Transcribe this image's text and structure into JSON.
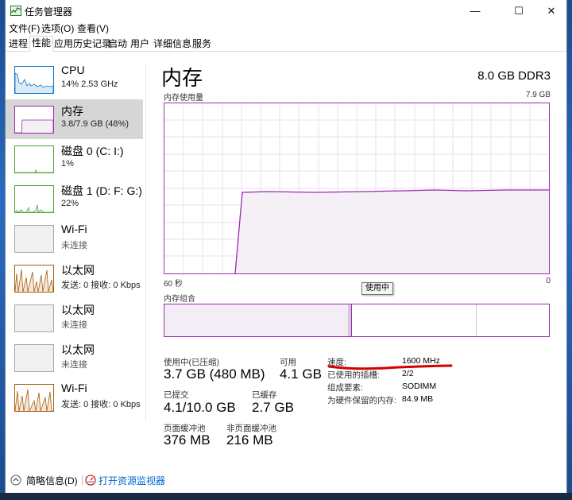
{
  "window": {
    "title": "任务管理器",
    "controls": {
      "minimize": "—",
      "maximize": "☐",
      "close": "✕"
    }
  },
  "menu": [
    "文件(F)",
    "选项(O)",
    "查看(V)"
  ],
  "tabs": [
    "进程",
    "性能",
    "应用历史记录",
    "启动",
    "用户",
    "详细信息",
    "服务"
  ],
  "active_tab": "性能",
  "sidebar": {
    "items": [
      {
        "name": "CPU",
        "sub": "14% 2.53 GHz",
        "selected": false,
        "color": "#1174c8"
      },
      {
        "name": "内存",
        "sub": "3.8/7.9 GB (48%)",
        "selected": true,
        "color": "#9b2cad"
      },
      {
        "name": "磁盘 0 (C: I:)",
        "sub": "1%",
        "selected": false,
        "color": "#4ea72e"
      },
      {
        "name": "磁盘 1 (D: F: G:)",
        "sub": "22%",
        "selected": false,
        "color": "#4ea72e"
      },
      {
        "name": "Wi-Fi",
        "sub": "未连接",
        "selected": false,
        "color": "#a7a7a7"
      },
      {
        "name": "以太网",
        "sub": "发送: 0 接收: 0 Kbps",
        "selected": false,
        "color": "#a75d12"
      },
      {
        "name": "以太网",
        "sub": "未连接",
        "selected": false,
        "color": "#a7a7a7"
      },
      {
        "name": "以太网",
        "sub": "未连接",
        "selected": false,
        "color": "#a7a7a7"
      },
      {
        "name": "Wi-Fi",
        "sub": "发送: 0 接收: 0 Kbps",
        "selected": false,
        "color": "#a75d12"
      }
    ]
  },
  "memory": {
    "title": "内存",
    "spec": "8.0 GB DDR3",
    "usage_label": "内存使用量",
    "max_label": "7.9 GB",
    "axis_left": "60 秒",
    "axis_right": "0",
    "tooltip": "使用中",
    "composition_label": "内存组合",
    "stats": {
      "in_use_label": "使用中(已压缩)",
      "in_use_value": "3.7 GB (480 MB)",
      "available_label": "可用",
      "available_value": "4.1 GB",
      "committed_label": "已提交",
      "committed_value": "4.1/10.0 GB",
      "cached_label": "已缓存",
      "cached_value": "2.7 GB",
      "paged_label": "页面缓冲池",
      "paged_value": "376 MB",
      "nonpaged_label": "非页面缓冲池",
      "nonpaged_value": "216 MB"
    },
    "details": {
      "speed_label": "速度:",
      "speed_value": "1600 MHz",
      "slots_label": "已使用的插槽:",
      "slots_value": "2/2",
      "form_label": "组成要素:",
      "form_value": "SODIMM",
      "reserved_label": "为硬件保留的内存:",
      "reserved_value": "84.9 MB"
    }
  },
  "footer": {
    "summary": "简略信息(D)",
    "monitor": "打开资源监视器"
  },
  "colors": {
    "memory_accent": "#9b2cad",
    "memory_fill": "#f4f0f6",
    "annotation_red": "#d40000"
  }
}
